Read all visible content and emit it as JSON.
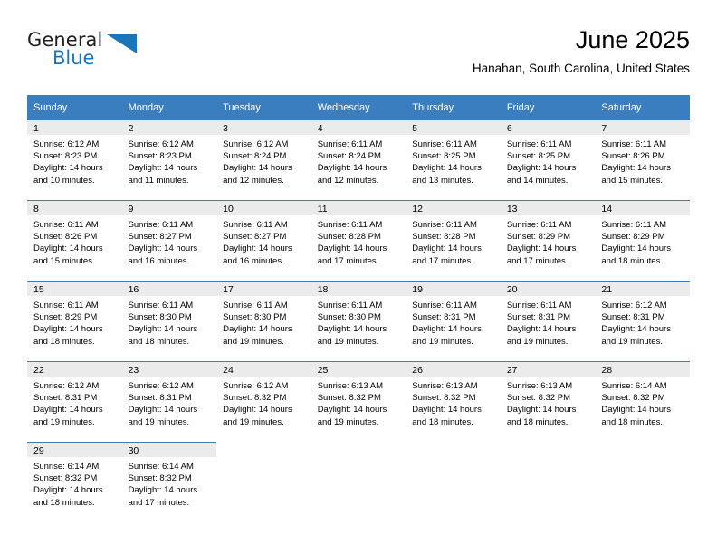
{
  "brand": {
    "name_top": "General",
    "name_bottom": "Blue",
    "color_dark": "#231f20",
    "color_blue": "#1b75bb"
  },
  "header": {
    "title": "June 2025",
    "subtitle": "Hanahan, South Carolina, United States"
  },
  "theme": {
    "header_blue": "#3a7ebf",
    "daynum_band": "#ebebeb",
    "text": "#000000"
  },
  "calendar": {
    "weekday_headers": [
      "Sunday",
      "Monday",
      "Tuesday",
      "Wednesday",
      "Thursday",
      "Friday",
      "Saturday"
    ],
    "labels": {
      "sunrise": "Sunrise:",
      "sunset": "Sunset:",
      "daylight": "Daylight:"
    },
    "weeks": [
      [
        {
          "day": "1",
          "sunrise": "Sunrise: 6:12 AM",
          "sunset": "Sunset: 8:23 PM",
          "daylight": "Daylight: 14 hours and 10 minutes."
        },
        {
          "day": "2",
          "sunrise": "Sunrise: 6:12 AM",
          "sunset": "Sunset: 8:23 PM",
          "daylight": "Daylight: 14 hours and 11 minutes."
        },
        {
          "day": "3",
          "sunrise": "Sunrise: 6:12 AM",
          "sunset": "Sunset: 8:24 PM",
          "daylight": "Daylight: 14 hours and 12 minutes."
        },
        {
          "day": "4",
          "sunrise": "Sunrise: 6:11 AM",
          "sunset": "Sunset: 8:24 PM",
          "daylight": "Daylight: 14 hours and 12 minutes."
        },
        {
          "day": "5",
          "sunrise": "Sunrise: 6:11 AM",
          "sunset": "Sunset: 8:25 PM",
          "daylight": "Daylight: 14 hours and 13 minutes."
        },
        {
          "day": "6",
          "sunrise": "Sunrise: 6:11 AM",
          "sunset": "Sunset: 8:25 PM",
          "daylight": "Daylight: 14 hours and 14 minutes."
        },
        {
          "day": "7",
          "sunrise": "Sunrise: 6:11 AM",
          "sunset": "Sunset: 8:26 PM",
          "daylight": "Daylight: 14 hours and 15 minutes."
        }
      ],
      [
        {
          "day": "8",
          "sunrise": "Sunrise: 6:11 AM",
          "sunset": "Sunset: 8:26 PM",
          "daylight": "Daylight: 14 hours and 15 minutes."
        },
        {
          "day": "9",
          "sunrise": "Sunrise: 6:11 AM",
          "sunset": "Sunset: 8:27 PM",
          "daylight": "Daylight: 14 hours and 16 minutes."
        },
        {
          "day": "10",
          "sunrise": "Sunrise: 6:11 AM",
          "sunset": "Sunset: 8:27 PM",
          "daylight": "Daylight: 14 hours and 16 minutes."
        },
        {
          "day": "11",
          "sunrise": "Sunrise: 6:11 AM",
          "sunset": "Sunset: 8:28 PM",
          "daylight": "Daylight: 14 hours and 17 minutes."
        },
        {
          "day": "12",
          "sunrise": "Sunrise: 6:11 AM",
          "sunset": "Sunset: 8:28 PM",
          "daylight": "Daylight: 14 hours and 17 minutes."
        },
        {
          "day": "13",
          "sunrise": "Sunrise: 6:11 AM",
          "sunset": "Sunset: 8:29 PM",
          "daylight": "Daylight: 14 hours and 17 minutes."
        },
        {
          "day": "14",
          "sunrise": "Sunrise: 6:11 AM",
          "sunset": "Sunset: 8:29 PM",
          "daylight": "Daylight: 14 hours and 18 minutes."
        }
      ],
      [
        {
          "day": "15",
          "sunrise": "Sunrise: 6:11 AM",
          "sunset": "Sunset: 8:29 PM",
          "daylight": "Daylight: 14 hours and 18 minutes."
        },
        {
          "day": "16",
          "sunrise": "Sunrise: 6:11 AM",
          "sunset": "Sunset: 8:30 PM",
          "daylight": "Daylight: 14 hours and 18 minutes."
        },
        {
          "day": "17",
          "sunrise": "Sunrise: 6:11 AM",
          "sunset": "Sunset: 8:30 PM",
          "daylight": "Daylight: 14 hours and 19 minutes."
        },
        {
          "day": "18",
          "sunrise": "Sunrise: 6:11 AM",
          "sunset": "Sunset: 8:30 PM",
          "daylight": "Daylight: 14 hours and 19 minutes."
        },
        {
          "day": "19",
          "sunrise": "Sunrise: 6:11 AM",
          "sunset": "Sunset: 8:31 PM",
          "daylight": "Daylight: 14 hours and 19 minutes."
        },
        {
          "day": "20",
          "sunrise": "Sunrise: 6:11 AM",
          "sunset": "Sunset: 8:31 PM",
          "daylight": "Daylight: 14 hours and 19 minutes."
        },
        {
          "day": "21",
          "sunrise": "Sunrise: 6:12 AM",
          "sunset": "Sunset: 8:31 PM",
          "daylight": "Daylight: 14 hours and 19 minutes."
        }
      ],
      [
        {
          "day": "22",
          "sunrise": "Sunrise: 6:12 AM",
          "sunset": "Sunset: 8:31 PM",
          "daylight": "Daylight: 14 hours and 19 minutes."
        },
        {
          "day": "23",
          "sunrise": "Sunrise: 6:12 AM",
          "sunset": "Sunset: 8:31 PM",
          "daylight": "Daylight: 14 hours and 19 minutes."
        },
        {
          "day": "24",
          "sunrise": "Sunrise: 6:12 AM",
          "sunset": "Sunset: 8:32 PM",
          "daylight": "Daylight: 14 hours and 19 minutes."
        },
        {
          "day": "25",
          "sunrise": "Sunrise: 6:13 AM",
          "sunset": "Sunset: 8:32 PM",
          "daylight": "Daylight: 14 hours and 19 minutes."
        },
        {
          "day": "26",
          "sunrise": "Sunrise: 6:13 AM",
          "sunset": "Sunset: 8:32 PM",
          "daylight": "Daylight: 14 hours and 18 minutes."
        },
        {
          "day": "27",
          "sunrise": "Sunrise: 6:13 AM",
          "sunset": "Sunset: 8:32 PM",
          "daylight": "Daylight: 14 hours and 18 minutes."
        },
        {
          "day": "28",
          "sunrise": "Sunrise: 6:14 AM",
          "sunset": "Sunset: 8:32 PM",
          "daylight": "Daylight: 14 hours and 18 minutes."
        }
      ],
      [
        {
          "day": "29",
          "sunrise": "Sunrise: 6:14 AM",
          "sunset": "Sunset: 8:32 PM",
          "daylight": "Daylight: 14 hours and 18 minutes."
        },
        {
          "day": "30",
          "sunrise": "Sunrise: 6:14 AM",
          "sunset": "Sunset: 8:32 PM",
          "daylight": "Daylight: 14 hours and 17 minutes."
        },
        null,
        null,
        null,
        null,
        null
      ]
    ]
  }
}
